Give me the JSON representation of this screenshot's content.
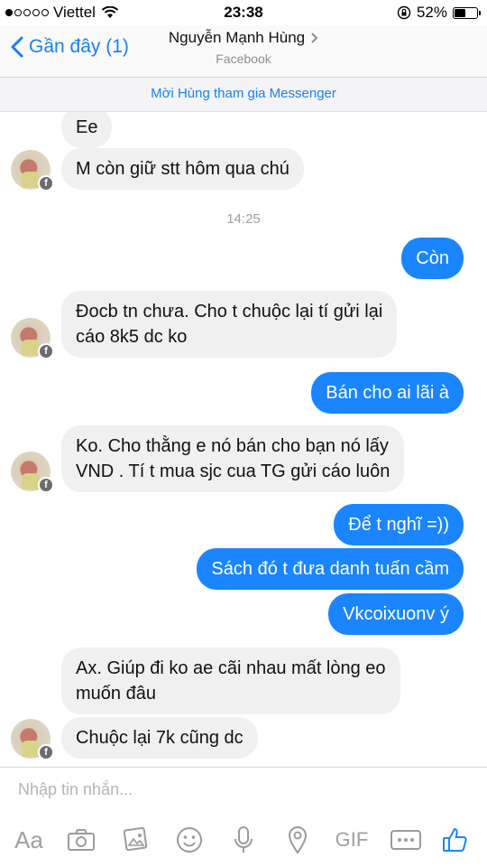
{
  "status_bar": {
    "carrier": "Viettel",
    "time": "23:38",
    "battery": "52%"
  },
  "header": {
    "back_label": "Gần đây (1)",
    "contact_name": "Nguyễn Mạnh Hùng",
    "contact_sub": "Facebook"
  },
  "invite_banner": "Mời Hùng tham gia Messenger",
  "thread": {
    "m1": "Ee",
    "m2": "M còn giữ stt hôm qua chú",
    "timestamp": "14:25",
    "m3": "Còn",
    "m4_l1": "Đocb tn chưa. Cho t chuộc lại tí gửi lại",
    "m4_l2": "cáo 8k5 dc ko",
    "m5": "Bán cho ai lãi à",
    "m6_l1": "Ko. Cho thằng e nó bán cho bạn nó lấy",
    "m6_l2": "VND . Tí t mua sjc cua TG gửi cáo luôn",
    "m7": "Để t nghĩ =))",
    "m8": "Sách đó t đưa danh tuấn cầm",
    "m9": "Vkcoixuonv ý",
    "m10_l1": "Ax. Giúp đi ko ae cãi nhau mất lòng eo",
    "m10_l2": "muốn đâu",
    "m11": "Chuộc lại 7k cũng dc"
  },
  "composer": {
    "placeholder": "Nhập tin nhắn...",
    "aa_label": "Aa",
    "gif_label": "GIF",
    "icons": [
      "camera-icon",
      "photo-icon",
      "emoji-icon",
      "microphone-icon",
      "location-icon",
      "more-icon",
      "like-icon"
    ]
  },
  "colors": {
    "accent": "#1a85ff",
    "incoming_bubble": "#f0f0f0"
  }
}
